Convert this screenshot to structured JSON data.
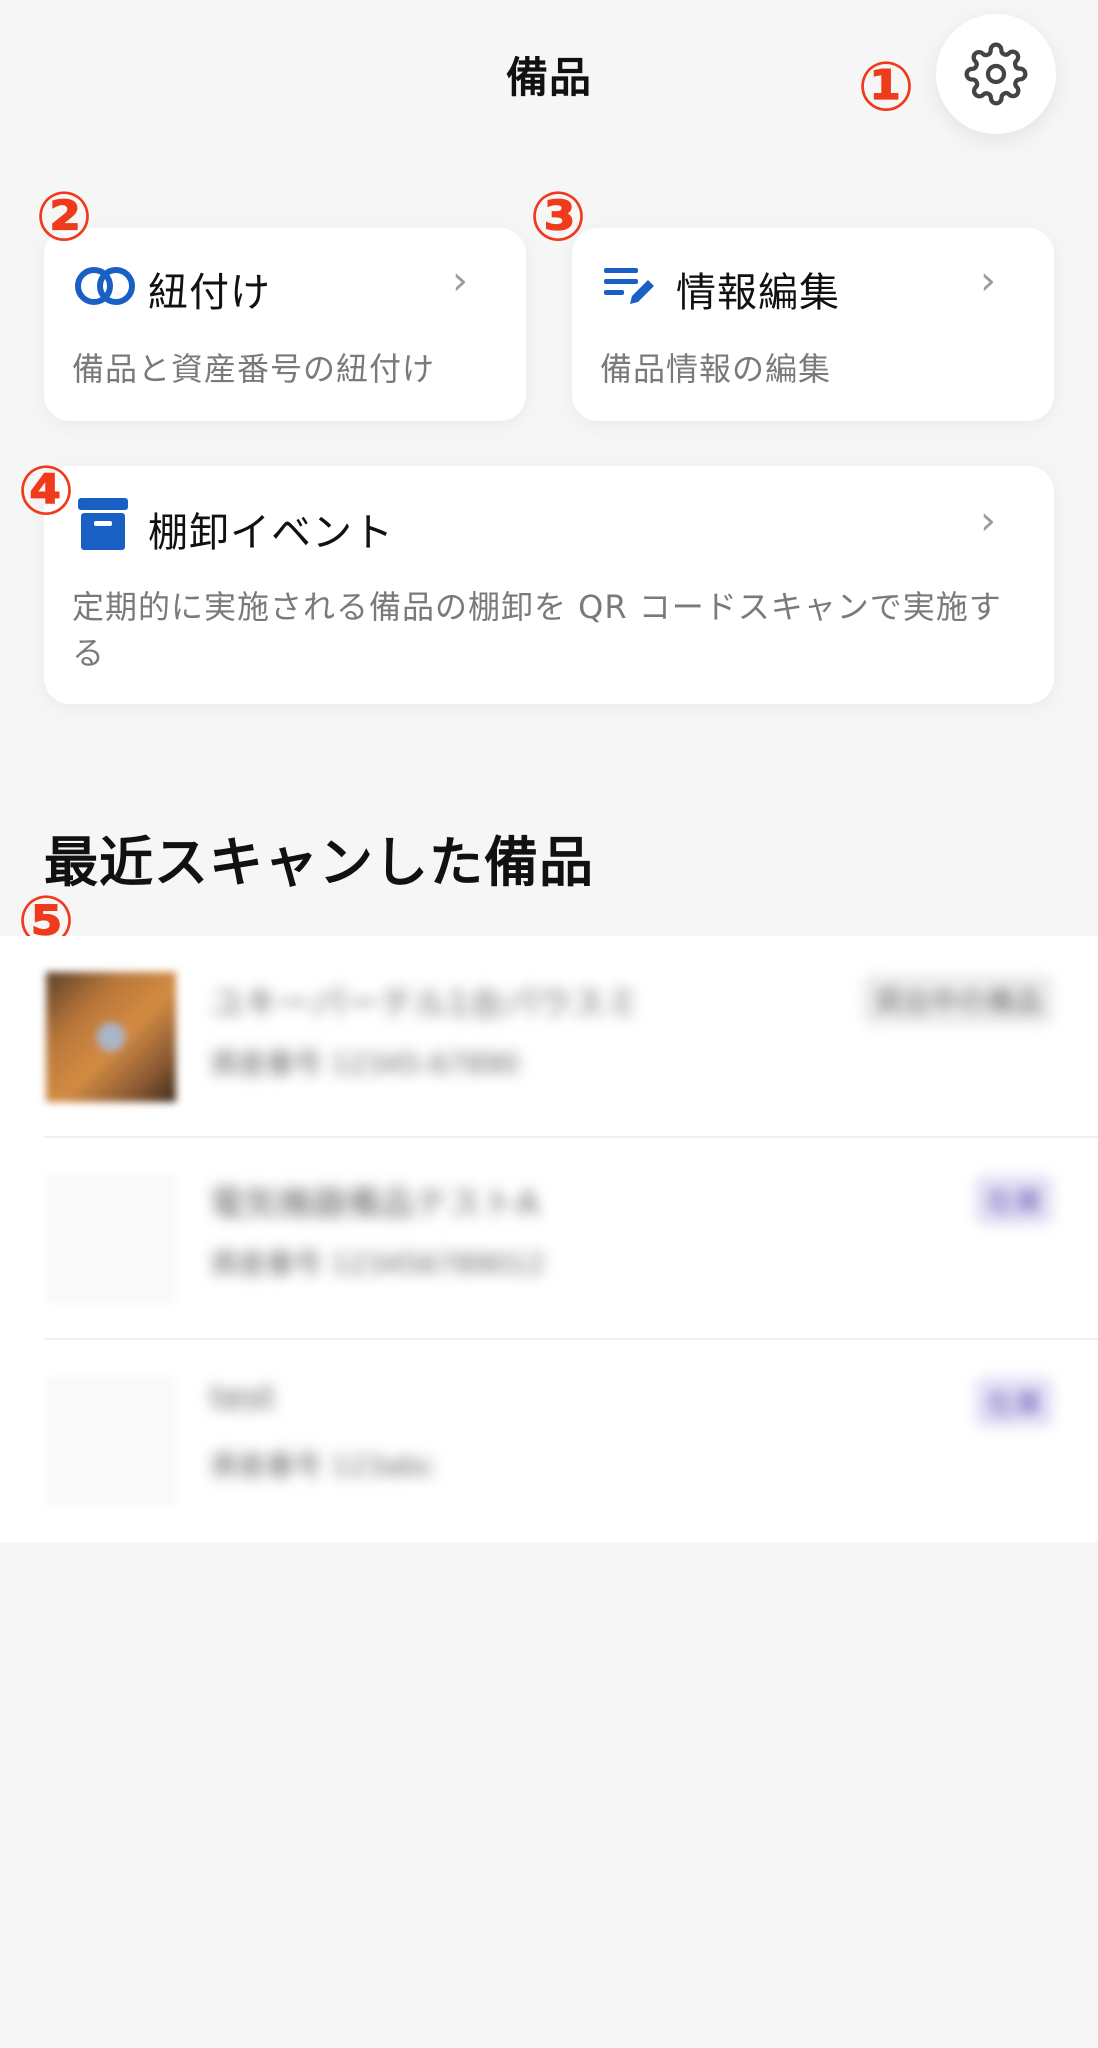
{
  "header": {
    "title": "備品",
    "settings_icon": "gear-icon"
  },
  "markers": [
    "①",
    "②",
    "③",
    "④",
    "⑤"
  ],
  "cards": {
    "link": {
      "title": "紐付け",
      "desc": "備品と資産番号の紐付け",
      "icon": "link-rings-icon",
      "icon_color": "#1a5fc4"
    },
    "edit": {
      "title": "情報編集",
      "desc": "備品情報の編集",
      "icon": "edit-list-icon",
      "icon_color": "#1a5fc4"
    },
    "inventory": {
      "title": "棚卸イベント",
      "desc": "定期的に実施される備品の棚卸を QR コードスキャンで実施する",
      "icon": "archive-box-icon",
      "icon_color": "#1a5fc4"
    },
    "chevron": "›"
  },
  "recent": {
    "title": "最近スキャンした備品",
    "items": [
      {
        "name": "ユキーパーテル1台パウスミ",
        "meta": "資産番号 12345-67890",
        "badge": "貸出中の備品"
      },
      {
        "name": "電気機器備品テストA",
        "meta": "資産番号 123456789012",
        "badge": "在庫"
      },
      {
        "name": "test",
        "meta": "資産番号 123abc",
        "badge": "在庫"
      }
    ]
  },
  "colors": {
    "accent": "#1a5fc4",
    "marker": "#ef3b1c",
    "background": "#f6f6f7"
  }
}
